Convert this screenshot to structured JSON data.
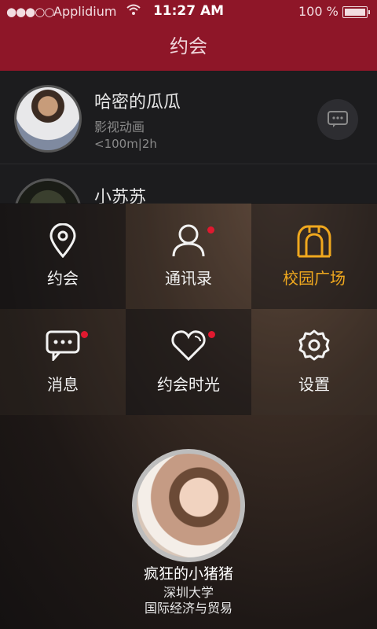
{
  "status_bar": {
    "signal": "●●●○○",
    "carrier": "Applidium",
    "time": "11:27 AM",
    "battery": "100 %"
  },
  "navbar": {
    "title": "约会"
  },
  "list": [
    {
      "name": "哈密的瓜瓜",
      "tag": "影视动画",
      "meta": "<100m|2h"
    },
    {
      "name": "小苏苏"
    }
  ],
  "menu": [
    {
      "label": "约会",
      "icon": "location-pin-icon",
      "badge": false,
      "highlight": false
    },
    {
      "label": "通讯录",
      "icon": "person-icon",
      "badge": true,
      "highlight": false
    },
    {
      "label": "校园广场",
      "icon": "campus-gate-icon",
      "badge": false,
      "highlight": true
    },
    {
      "label": "消息",
      "icon": "chat-bubble-icon",
      "badge": true,
      "highlight": false
    },
    {
      "label": "约会时光",
      "icon": "heart-icon",
      "badge": true,
      "highlight": false
    },
    {
      "label": "设置",
      "icon": "gear-icon",
      "badge": false,
      "highlight": false
    }
  ],
  "profile": {
    "name": "疯狂的小猪猪",
    "school": "深圳大学",
    "major": "国际经济与贸易"
  },
  "colors": {
    "brand": "#8e1628",
    "highlight": "#f0a81e",
    "badge": "#e0192f"
  }
}
